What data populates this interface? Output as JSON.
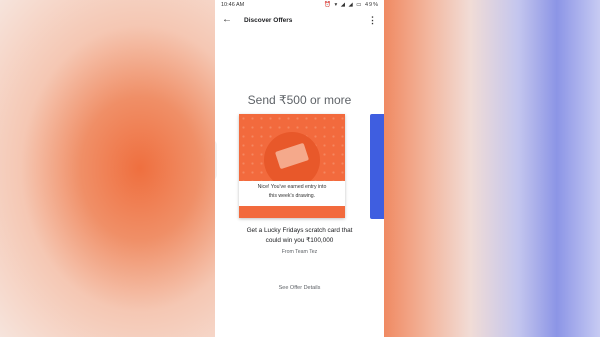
{
  "status_bar": {
    "time": "10:46 AM",
    "icons": "⏰ ▾ ◢ ◢ ▭ 49%"
  },
  "app_bar": {
    "back_icon": "←",
    "title": "Discover Offers",
    "more_icon": "⋮"
  },
  "offer": {
    "title": "Send ₹500 or more",
    "card_message_line1": "Nice! You've earned entry into",
    "card_message_line2": "this week's drawing.",
    "description_line1": "Get a Lucky Fridays scratch card that",
    "description_line2": "could win you ₹100,000",
    "from": "From Team Tez",
    "details_link": "See Offer Details"
  },
  "colors": {
    "card_orange": "#f26a3d",
    "side_card_blue": "#3f5ee0"
  }
}
